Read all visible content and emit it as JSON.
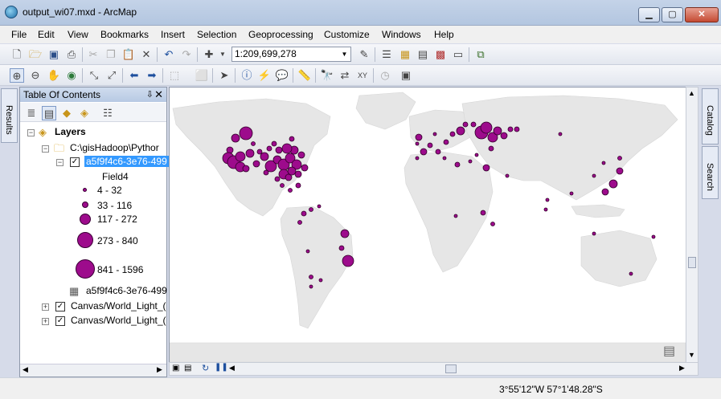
{
  "window": {
    "title": "output_wi07.mxd - ArcMap",
    "min_label": "▁",
    "max_label": "▢",
    "close_label": "✕"
  },
  "menu": [
    {
      "label": "File"
    },
    {
      "label": "Edit"
    },
    {
      "label": "View"
    },
    {
      "label": "Bookmarks"
    },
    {
      "label": "Insert"
    },
    {
      "label": "Selection"
    },
    {
      "label": "Geoprocessing"
    },
    {
      "label": "Customize"
    },
    {
      "label": "Windows"
    },
    {
      "label": "Help"
    }
  ],
  "toolbar": {
    "scale": "1:209,699,278"
  },
  "side_tabs": {
    "results": "Results",
    "catalog": "Catalog",
    "search": "Search"
  },
  "toc": {
    "title": "Table Of Contents",
    "pin": "⇩",
    "close": "✕",
    "layers_label": "Layers",
    "folder_label": "C:\\gisHadoop\\Pythor",
    "layer_name": "a5f9f4c6-3e76-499",
    "field_name": "Field4",
    "classes": [
      {
        "label": "4 - 32"
      },
      {
        "label": "33 - 116"
      },
      {
        "label": "117 - 272"
      },
      {
        "label": "273 - 840"
      },
      {
        "label": "841 - 1596"
      }
    ],
    "table_name": "a5f9f4c6-3e76-499",
    "basemaps": [
      {
        "label": "Canvas/World_Light_("
      },
      {
        "label": "Canvas/World_Light_("
      }
    ]
  },
  "status": {
    "coordinates": "3°55'12\"W  57°1'48.28\"S"
  },
  "colors": {
    "symbol_fill": "#9d0b8c",
    "ocean": "#ffffff",
    "land": "#e6e6e6",
    "selection": "#3399ff"
  },
  "icons": {
    "zoom_in": "zoom-in-icon",
    "zoom_out": "zoom-out-icon",
    "pan": "pan-icon",
    "full_extent": "globe-icon",
    "identify": "identify-icon",
    "find": "binoculars-icon"
  }
}
